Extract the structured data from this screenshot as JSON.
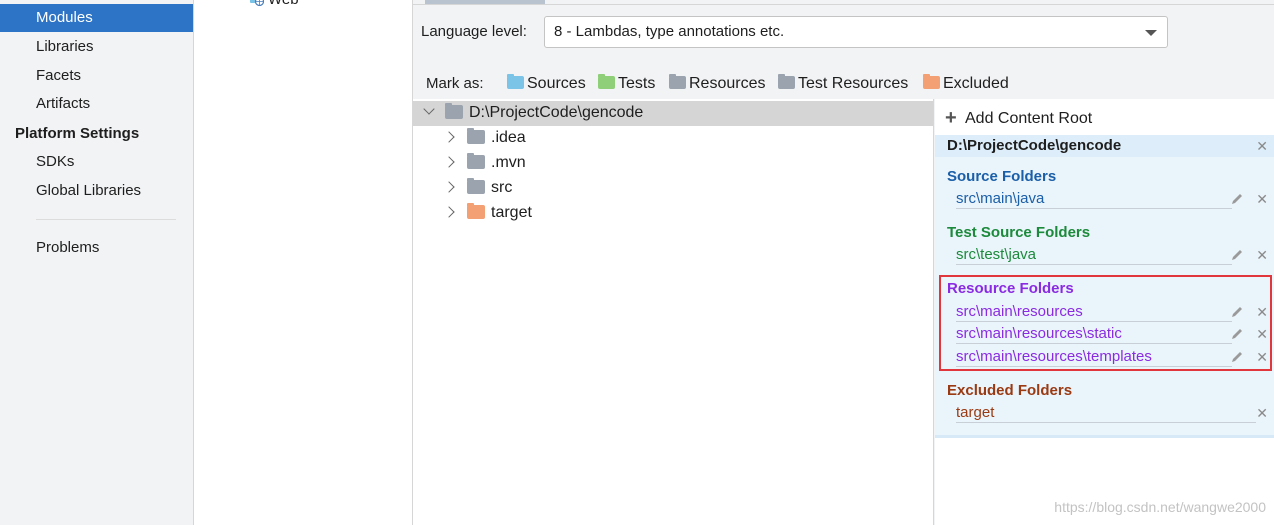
{
  "sidebar": {
    "items_top": [
      {
        "label": "Modules",
        "selected": true
      },
      {
        "label": "Libraries"
      },
      {
        "label": "Facets"
      },
      {
        "label": "Artifacts"
      }
    ],
    "platform_header": "Platform Settings",
    "items_platform": [
      {
        "label": "SDKs"
      },
      {
        "label": "Global Libraries"
      }
    ],
    "problems_label": "Problems"
  },
  "module_tree": {
    "web_label": "Web"
  },
  "language": {
    "label": "Language level:",
    "value": "8 - Lambdas, type annotations etc."
  },
  "mark_as": {
    "label": "Mark as:",
    "buttons": [
      {
        "label": "Sources",
        "color": "#7cc3e8"
      },
      {
        "label": "Tests",
        "color": "#8fcf7a"
      },
      {
        "label": "Resources",
        "color": "#9aa3ae"
      },
      {
        "label": "Test Resources",
        "color": "#9aa3ae"
      },
      {
        "label": "Excluded",
        "color": "#f2a074"
      }
    ]
  },
  "tree": {
    "root": "D:\\ProjectCode\\gencode",
    "children": [
      {
        "label": ".idea",
        "color": "#9aa3ae"
      },
      {
        "label": ".mvn",
        "color": "#9aa3ae"
      },
      {
        "label": "src",
        "color": "#9aa3ae"
      },
      {
        "label": "target",
        "color": "#f2a074"
      }
    ]
  },
  "content_root": {
    "add_label": "Add Content Root",
    "path": "D:\\ProjectCode\\gencode",
    "source": {
      "title": "Source Folders",
      "color": "#1a5fa8",
      "items": [
        "src\\main\\java"
      ]
    },
    "test": {
      "title": "Test Source Folders",
      "color": "#1c8a3b",
      "items": [
        "src\\test\\java"
      ]
    },
    "resource": {
      "title": "Resource Folders",
      "color": "#8a2be2",
      "items": [
        "src\\main\\resources",
        "src\\main\\resources\\static",
        "src\\main\\resources\\templates"
      ]
    },
    "excluded": {
      "title": "Excluded Folders",
      "color": "#9a3a12",
      "items": [
        "target"
      ]
    }
  },
  "watermark": "https://blog.csdn.net/wangwe2000",
  "colors": {
    "selection": "#2d74c7",
    "highlight_box": "#e0363c"
  }
}
